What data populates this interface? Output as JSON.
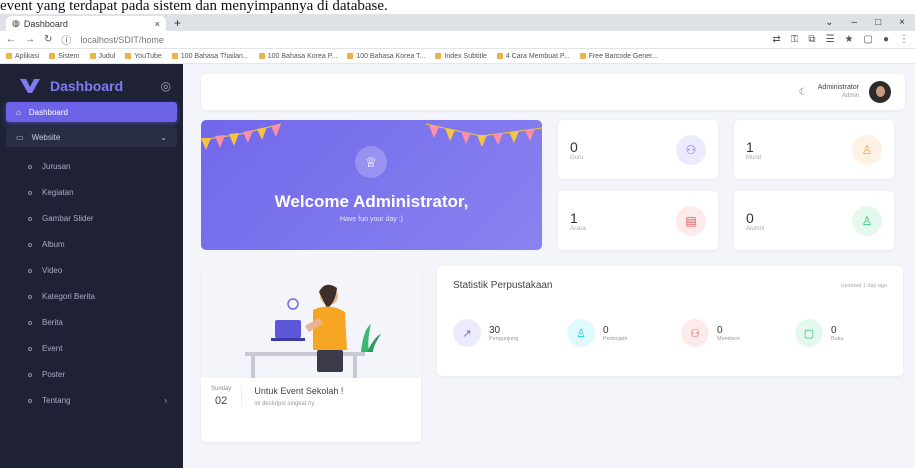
{
  "caption": "event yang terdapat pada sistem dan menyimpannya di database.",
  "browser": {
    "tab_title": "Dashboard",
    "url": "localhost/SDIT/home",
    "bookmarks": [
      "Aplikasi",
      "Sistem",
      "Judul",
      "YouTube",
      "100 Bahasa Thailan...",
      "100 Bahasa Korea P...",
      "100 Bahasa Korea T...",
      "Index Subtitle",
      "4 Cara Membuat P...",
      "Free Barcode Gener..."
    ]
  },
  "sidebar": {
    "brand": "Dashboard",
    "items": [
      {
        "label": "Dashboard",
        "state": "active",
        "icon": "home-icon"
      },
      {
        "label": "Website",
        "state": "open",
        "icon": "monitor-icon"
      }
    ],
    "subitems": [
      "Jurusan",
      "Kegiatan",
      "Gambar Slider",
      "Album",
      "Video",
      "Kategori Berita",
      "Berita",
      "Event",
      "Poster",
      "Tentang"
    ]
  },
  "topbar": {
    "user_name": "Administrator",
    "user_role": "Admin"
  },
  "welcome": {
    "title": "Welcome Administrator,",
    "subtitle": "Have fun your day :)"
  },
  "stats": [
    {
      "value": "0",
      "label": "Guru",
      "color": "#7367f0",
      "bg": "#ecebfd",
      "icon": "users-icon"
    },
    {
      "value": "1",
      "label": "Murid",
      "color": "#ff9f43",
      "bg": "#fff1e3",
      "icon": "student-icon"
    },
    {
      "value": "1",
      "label": "Acara",
      "color": "#ea5455",
      "bg": "#fdeaea",
      "icon": "calendar-icon"
    },
    {
      "value": "0",
      "label": "Alumni",
      "color": "#28c76f",
      "bg": "#e5f8ed",
      "icon": "alumni-icon"
    }
  ],
  "event": {
    "day": "Sunday",
    "daynum": "02",
    "title": "Untuk Event Sekolah !",
    "desc": "ini deskripsi singkat ny"
  },
  "library": {
    "title": "Statistik Perpustakaan",
    "updated": "Updated 1 day ago",
    "items": [
      {
        "value": "30",
        "label": "Pengunjung",
        "color": "#7367f0",
        "bg": "#ecebfd",
        "icon": "trending-icon"
      },
      {
        "value": "0",
        "label": "Peminjam",
        "color": "#00cfe8",
        "bg": "#e0f9fc",
        "icon": "user-icon"
      },
      {
        "value": "0",
        "label": "Members",
        "color": "#ea5455",
        "bg": "#fdeaea",
        "icon": "members-icon"
      },
      {
        "value": "0",
        "label": "Buku",
        "color": "#28c76f",
        "bg": "#e5f8ed",
        "icon": "book-icon"
      }
    ]
  }
}
